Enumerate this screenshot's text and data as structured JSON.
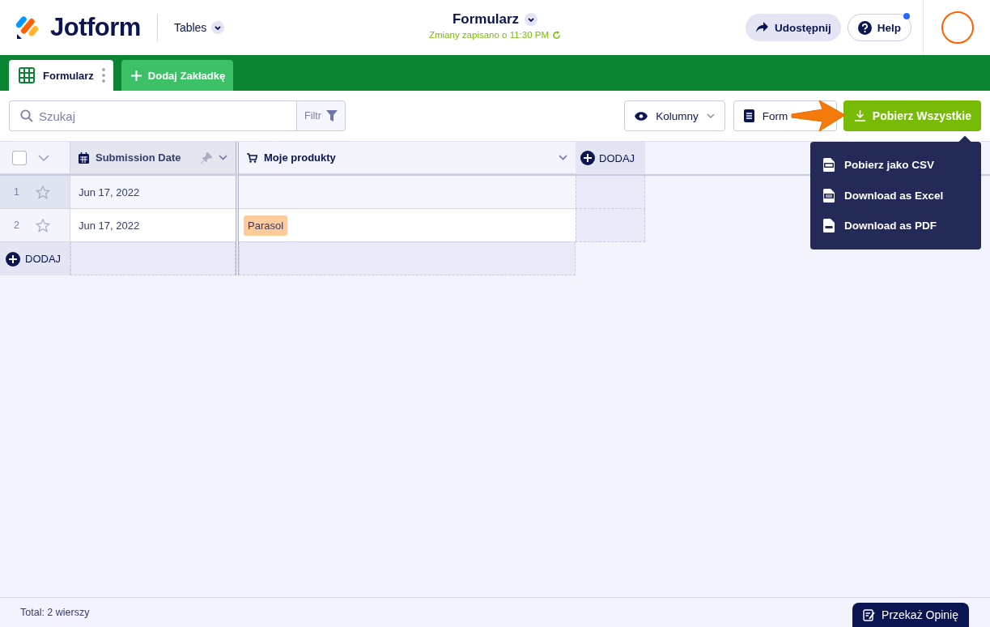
{
  "header": {
    "logo": "Jotform",
    "app_menu": "Tables",
    "title": "Formularz",
    "save_status": "Zmiany zapisano o 11:30 PM",
    "share_button": "Udostępnij",
    "help_button": "Help",
    "help_notification": true
  },
  "tabs": [
    {
      "label": "Formularz",
      "selected": true
    }
  ],
  "add_tab_button": "Dodaj Zakładkę",
  "toolbar": {
    "search": {
      "placeholder": "Szukaj"
    },
    "filter_button": "Filtr",
    "columns_button": "Kolumny",
    "form_button": "Form",
    "download_button": "Pobierz Wszystkie"
  },
  "download_menu": [
    {
      "label": "Pobierz jako CSV",
      "kind": "csv"
    },
    {
      "label": "Download as Excel",
      "kind": "xls"
    },
    {
      "label": "Download as PDF",
      "kind": "pdf"
    }
  ],
  "table": {
    "select_all_checked": false,
    "columns": [
      {
        "label": "Submission Date",
        "kind": "date"
      },
      {
        "label": "Moje produkty",
        "kind": "cart"
      }
    ],
    "add_column": "DODAJ",
    "rows": [
      {
        "number": "1",
        "starred": false,
        "selected": true,
        "cells": [
          "Jun 17, 2022",
          ""
        ]
      },
      {
        "number": "2",
        "starred": false,
        "selected": false,
        "cells": [
          "Jun 17, 2022",
          "Parasol"
        ]
      }
    ],
    "add_row": "DODAJ"
  },
  "footer": {
    "total": "Total: 2 wierszy",
    "feedback_button": "Przekaż Opinię"
  }
}
